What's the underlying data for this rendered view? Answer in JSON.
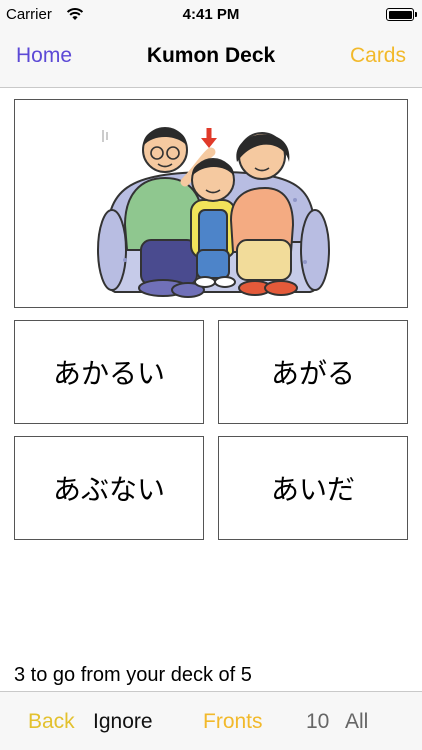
{
  "status_bar": {
    "carrier": "Carrier",
    "time": "4:41 PM"
  },
  "nav": {
    "back_label": "Home",
    "title": "Kumon Deck",
    "cards_label": "Cards"
  },
  "picture": {
    "icon": "family-on-sofa-illustration"
  },
  "cards": [
    "あかるい",
    "あがる",
    "あぶない",
    "あいだ"
  ],
  "progress_text": "3 to go from your deck of 5",
  "toolbar": {
    "back": "Back",
    "ignore": "Ignore",
    "fronts": "Fronts",
    "count": "10",
    "all": "All"
  },
  "colors": {
    "purple": "#5c49d6",
    "yellow": "#f2b92b",
    "bar": "#f7f7f7"
  }
}
